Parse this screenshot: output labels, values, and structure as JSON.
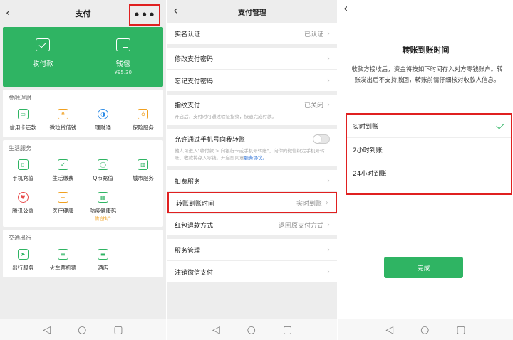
{
  "panel1": {
    "title": "支付",
    "back_icon": "chevron-left-icon",
    "more_icon": "•••",
    "green_card": {
      "pay": "收付款",
      "wallet": "钱包",
      "wallet_balance": "¥95.30"
    },
    "sections": [
      {
        "title": "金融理财",
        "items": [
          {
            "label": "信用卡还款",
            "icon": "credit-card-icon"
          },
          {
            "label": "微粒贷借钱",
            "icon": "loan-icon"
          },
          {
            "label": "理财通",
            "icon": "wealth-icon"
          },
          {
            "label": "保险服务",
            "icon": "insurance-icon"
          }
        ]
      },
      {
        "title": "生活服务",
        "items": [
          {
            "label": "手机充值",
            "icon": "phone-recharge-icon"
          },
          {
            "label": "生活缴费",
            "icon": "utility-icon"
          },
          {
            "label": "Q币充值",
            "icon": "qcoin-icon"
          },
          {
            "label": "城市服务",
            "icon": "city-icon"
          },
          {
            "label": "腾讯公益",
            "icon": "charity-icon"
          },
          {
            "label": "医疗健康",
            "icon": "medical-icon"
          },
          {
            "label": "防疫健康码",
            "icon": "health-code-icon",
            "tag": "微信推广"
          }
        ]
      },
      {
        "title": "交通出行",
        "items": [
          {
            "label": "出行服务",
            "icon": "travel-icon"
          },
          {
            "label": "火车票机票",
            "icon": "train-icon"
          },
          {
            "label": "酒店",
            "icon": "hotel-icon"
          }
        ]
      }
    ]
  },
  "panel2": {
    "title": "支付管理",
    "rows": {
      "realname": {
        "label": "实名认证",
        "value": "已认证"
      },
      "change_pwd": {
        "label": "修改支付密码"
      },
      "forgot_pwd": {
        "label": "忘记支付密码"
      },
      "fingerprint": {
        "label": "指纹支付",
        "value": "已关闭",
        "desc": "开启后，支付时可通过验证指纹，快速完成付款。"
      },
      "allow_transfer": {
        "label": "允许通过手机号向我转账",
        "desc": "他人可进入\"收付款 > 向银行卡或手机号转账\"，向你的微信绑定手机号转账，收款将存入零钱。开启即同意",
        "link": "服务协议。"
      },
      "deduction": {
        "label": "扣费服务"
      },
      "arrival_time": {
        "label": "转账到账时间",
        "value": "实时到账"
      },
      "refund": {
        "label": "红包退款方式",
        "value": "退回原支付方式"
      },
      "service_mgmt": {
        "label": "服务管理"
      },
      "cancel_pay": {
        "label": "注销微信支付"
      }
    }
  },
  "panel3": {
    "title": "转账到账时间",
    "desc": "收款方接收后，资金将按如下时间存入对方零钱账户。转账发出后不支持撤回，转账前请仔细核对收款人信息。",
    "options": [
      {
        "label": "实时到账",
        "selected": true
      },
      {
        "label": "2小时到账",
        "selected": false
      },
      {
        "label": "24小时到账",
        "selected": false
      }
    ],
    "done": "完成"
  },
  "nav": {
    "back": "◁",
    "home": "○",
    "recent": "▢"
  },
  "colors": {
    "accent": "#2fb463",
    "highlight": "#e02020",
    "link": "#2a6fd6"
  }
}
